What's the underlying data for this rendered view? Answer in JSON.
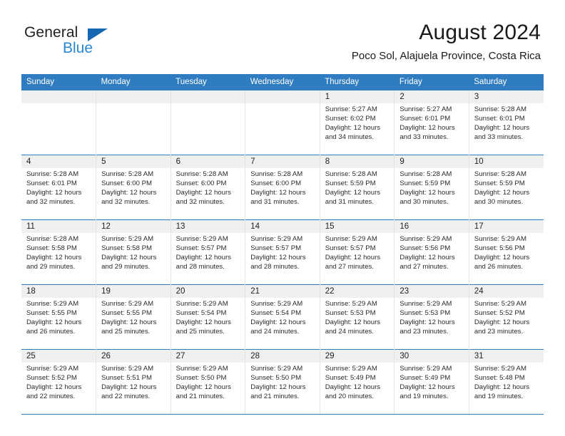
{
  "brand": {
    "name_top": "General",
    "name_bottom": "Blue"
  },
  "header": {
    "title": "August 2024",
    "subtitle": "Poco Sol, Alajuela Province, Costa Rica"
  },
  "colors": {
    "header_blue": "#2f7dc0",
    "logo_blue": "#2a87d0",
    "daynum_band": "#f0f0f0"
  },
  "weekday_headers": [
    "Sunday",
    "Monday",
    "Tuesday",
    "Wednesday",
    "Thursday",
    "Friday",
    "Saturday"
  ],
  "weeks": [
    [
      {
        "day": "",
        "lines": []
      },
      {
        "day": "",
        "lines": []
      },
      {
        "day": "",
        "lines": []
      },
      {
        "day": "",
        "lines": []
      },
      {
        "day": "1",
        "lines": [
          "Sunrise: 5:27 AM",
          "Sunset: 6:02 PM",
          "Daylight: 12 hours",
          "and 34 minutes."
        ]
      },
      {
        "day": "2",
        "lines": [
          "Sunrise: 5:27 AM",
          "Sunset: 6:01 PM",
          "Daylight: 12 hours",
          "and 33 minutes."
        ]
      },
      {
        "day": "3",
        "lines": [
          "Sunrise: 5:28 AM",
          "Sunset: 6:01 PM",
          "Daylight: 12 hours",
          "and 33 minutes."
        ]
      }
    ],
    [
      {
        "day": "4",
        "lines": [
          "Sunrise: 5:28 AM",
          "Sunset: 6:01 PM",
          "Daylight: 12 hours",
          "and 32 minutes."
        ]
      },
      {
        "day": "5",
        "lines": [
          "Sunrise: 5:28 AM",
          "Sunset: 6:00 PM",
          "Daylight: 12 hours",
          "and 32 minutes."
        ]
      },
      {
        "day": "6",
        "lines": [
          "Sunrise: 5:28 AM",
          "Sunset: 6:00 PM",
          "Daylight: 12 hours",
          "and 32 minutes."
        ]
      },
      {
        "day": "7",
        "lines": [
          "Sunrise: 5:28 AM",
          "Sunset: 6:00 PM",
          "Daylight: 12 hours",
          "and 31 minutes."
        ]
      },
      {
        "day": "8",
        "lines": [
          "Sunrise: 5:28 AM",
          "Sunset: 5:59 PM",
          "Daylight: 12 hours",
          "and 31 minutes."
        ]
      },
      {
        "day": "9",
        "lines": [
          "Sunrise: 5:28 AM",
          "Sunset: 5:59 PM",
          "Daylight: 12 hours",
          "and 30 minutes."
        ]
      },
      {
        "day": "10",
        "lines": [
          "Sunrise: 5:28 AM",
          "Sunset: 5:59 PM",
          "Daylight: 12 hours",
          "and 30 minutes."
        ]
      }
    ],
    [
      {
        "day": "11",
        "lines": [
          "Sunrise: 5:28 AM",
          "Sunset: 5:58 PM",
          "Daylight: 12 hours",
          "and 29 minutes."
        ]
      },
      {
        "day": "12",
        "lines": [
          "Sunrise: 5:29 AM",
          "Sunset: 5:58 PM",
          "Daylight: 12 hours",
          "and 29 minutes."
        ]
      },
      {
        "day": "13",
        "lines": [
          "Sunrise: 5:29 AM",
          "Sunset: 5:57 PM",
          "Daylight: 12 hours",
          "and 28 minutes."
        ]
      },
      {
        "day": "14",
        "lines": [
          "Sunrise: 5:29 AM",
          "Sunset: 5:57 PM",
          "Daylight: 12 hours",
          "and 28 minutes."
        ]
      },
      {
        "day": "15",
        "lines": [
          "Sunrise: 5:29 AM",
          "Sunset: 5:57 PM",
          "Daylight: 12 hours",
          "and 27 minutes."
        ]
      },
      {
        "day": "16",
        "lines": [
          "Sunrise: 5:29 AM",
          "Sunset: 5:56 PM",
          "Daylight: 12 hours",
          "and 27 minutes."
        ]
      },
      {
        "day": "17",
        "lines": [
          "Sunrise: 5:29 AM",
          "Sunset: 5:56 PM",
          "Daylight: 12 hours",
          "and 26 minutes."
        ]
      }
    ],
    [
      {
        "day": "18",
        "lines": [
          "Sunrise: 5:29 AM",
          "Sunset: 5:55 PM",
          "Daylight: 12 hours",
          "and 26 minutes."
        ]
      },
      {
        "day": "19",
        "lines": [
          "Sunrise: 5:29 AM",
          "Sunset: 5:55 PM",
          "Daylight: 12 hours",
          "and 25 minutes."
        ]
      },
      {
        "day": "20",
        "lines": [
          "Sunrise: 5:29 AM",
          "Sunset: 5:54 PM",
          "Daylight: 12 hours",
          "and 25 minutes."
        ]
      },
      {
        "day": "21",
        "lines": [
          "Sunrise: 5:29 AM",
          "Sunset: 5:54 PM",
          "Daylight: 12 hours",
          "and 24 minutes."
        ]
      },
      {
        "day": "22",
        "lines": [
          "Sunrise: 5:29 AM",
          "Sunset: 5:53 PM",
          "Daylight: 12 hours",
          "and 24 minutes."
        ]
      },
      {
        "day": "23",
        "lines": [
          "Sunrise: 5:29 AM",
          "Sunset: 5:53 PM",
          "Daylight: 12 hours",
          "and 23 minutes."
        ]
      },
      {
        "day": "24",
        "lines": [
          "Sunrise: 5:29 AM",
          "Sunset: 5:52 PM",
          "Daylight: 12 hours",
          "and 23 minutes."
        ]
      }
    ],
    [
      {
        "day": "25",
        "lines": [
          "Sunrise: 5:29 AM",
          "Sunset: 5:52 PM",
          "Daylight: 12 hours",
          "and 22 minutes."
        ]
      },
      {
        "day": "26",
        "lines": [
          "Sunrise: 5:29 AM",
          "Sunset: 5:51 PM",
          "Daylight: 12 hours",
          "and 22 minutes."
        ]
      },
      {
        "day": "27",
        "lines": [
          "Sunrise: 5:29 AM",
          "Sunset: 5:50 PM",
          "Daylight: 12 hours",
          "and 21 minutes."
        ]
      },
      {
        "day": "28",
        "lines": [
          "Sunrise: 5:29 AM",
          "Sunset: 5:50 PM",
          "Daylight: 12 hours",
          "and 21 minutes."
        ]
      },
      {
        "day": "29",
        "lines": [
          "Sunrise: 5:29 AM",
          "Sunset: 5:49 PM",
          "Daylight: 12 hours",
          "and 20 minutes."
        ]
      },
      {
        "day": "30",
        "lines": [
          "Sunrise: 5:29 AM",
          "Sunset: 5:49 PM",
          "Daylight: 12 hours",
          "and 19 minutes."
        ]
      },
      {
        "day": "31",
        "lines": [
          "Sunrise: 5:29 AM",
          "Sunset: 5:48 PM",
          "Daylight: 12 hours",
          "and 19 minutes."
        ]
      }
    ]
  ]
}
